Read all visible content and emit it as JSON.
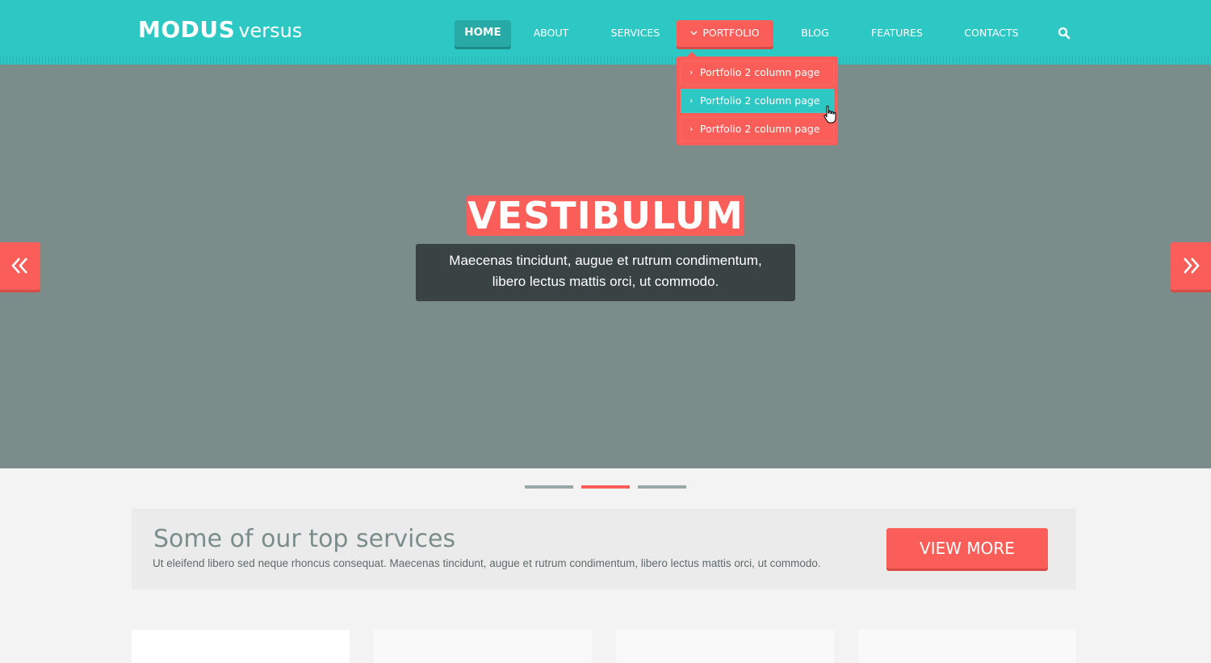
{
  "logo": {
    "strong": "MODUS",
    "light": "versus"
  },
  "nav": {
    "items": [
      {
        "label": "HOME"
      },
      {
        "label": "ABOUT"
      },
      {
        "label": "SERVICES"
      },
      {
        "label": "PORTFOLIO"
      },
      {
        "label": "BLOG"
      },
      {
        "label": "FEATURES"
      },
      {
        "label": "CONTACTS"
      }
    ],
    "search_icon": "search-icon"
  },
  "dropdown": {
    "items": [
      {
        "label": "Portfolio 2 column page"
      },
      {
        "label": "Portfolio 2 column page"
      },
      {
        "label": "Portfolio 2 column page"
      }
    ]
  },
  "hero": {
    "title": "VESTIBULUM",
    "caption_line1": "Maecenas tincidunt, augue et rutrum condimentum,",
    "caption_line2": "libero lectus mattis orci, ut commodo.",
    "prev_icon": "double-chevron-left-icon",
    "next_icon": "double-chevron-right-icon",
    "slides_count": 3,
    "active_slide": 2
  },
  "services": {
    "title": "Some of our top services",
    "text": "Ut eleifend libero sed neque rhoncus consequat. Maecenas tincidunt, augue et rutrum condimentum, libero lectus mattis orci, ut commodo.",
    "button": "VIEW MORE"
  },
  "colors": {
    "brand_teal": "#2ec8c4",
    "accent_coral": "#fb5e58",
    "hero_bg": "#7b8d8b",
    "caption_bg": "#3a4343"
  }
}
